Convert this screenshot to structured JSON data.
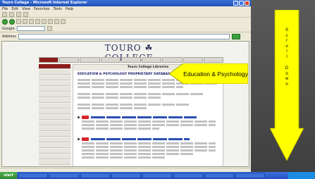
{
  "browser": {
    "title": "Touro College - Microsoft Internet Explorer",
    "menu": [
      "File",
      "Edit",
      "View",
      "Favorites",
      "Tools",
      "Help"
    ],
    "google_label": "Google",
    "address_label": "Address",
    "go_label": "Go"
  },
  "page": {
    "logo_text": "TOURO ☘ COLLEGE",
    "top_nav": [
      "",
      "",
      "",
      "",
      "",
      "",
      "",
      "",
      ""
    ],
    "main_header": "Touro College Libraries",
    "main_subheader": "EDUCATION & PSYCHOLOGY PROPRIETARY DATABASES"
  },
  "taskbar": {
    "start_label": "start"
  },
  "annotations": {
    "callout_text": "Education & Psychology",
    "scroll_letters_top": [
      "S",
      "c",
      "r",
      "o",
      "l",
      "l"
    ],
    "scroll_letters_bottom": [
      "D",
      "o",
      "w",
      "n"
    ],
    "arrow_color": "#ffff00",
    "callout_color": "#ffff00"
  }
}
